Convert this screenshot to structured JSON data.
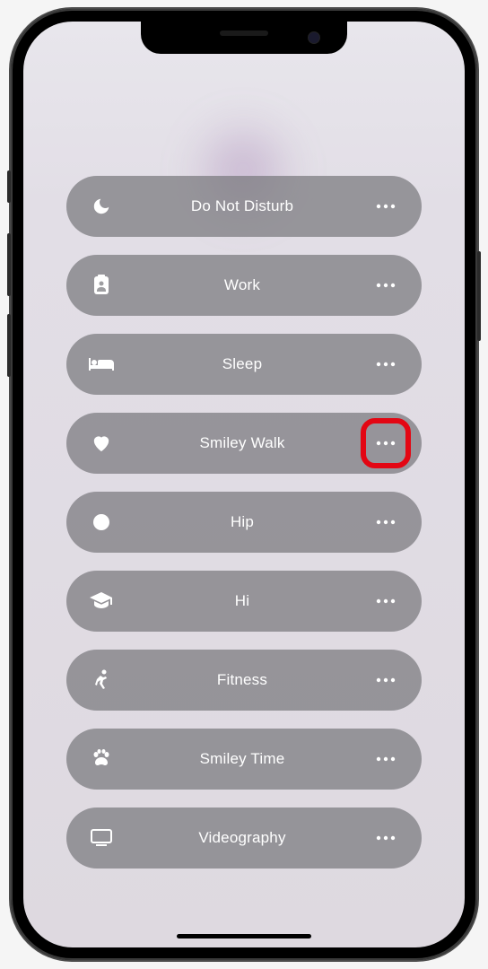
{
  "focus_modes": [
    {
      "icon": "moon",
      "label": "Do Not Disturb",
      "highlighted": false
    },
    {
      "icon": "badge",
      "label": "Work",
      "highlighted": false
    },
    {
      "icon": "bed",
      "label": "Sleep",
      "highlighted": false
    },
    {
      "icon": "heart",
      "label": "Smiley Walk",
      "highlighted": true
    },
    {
      "icon": "circle",
      "label": "Hip",
      "highlighted": false
    },
    {
      "icon": "graduation",
      "label": "Hi",
      "highlighted": false
    },
    {
      "icon": "runner",
      "label": "Fitness",
      "highlighted": false
    },
    {
      "icon": "paw",
      "label": "Smiley Time",
      "highlighted": false
    },
    {
      "icon": "display",
      "label": "Videography",
      "highlighted": false
    }
  ]
}
